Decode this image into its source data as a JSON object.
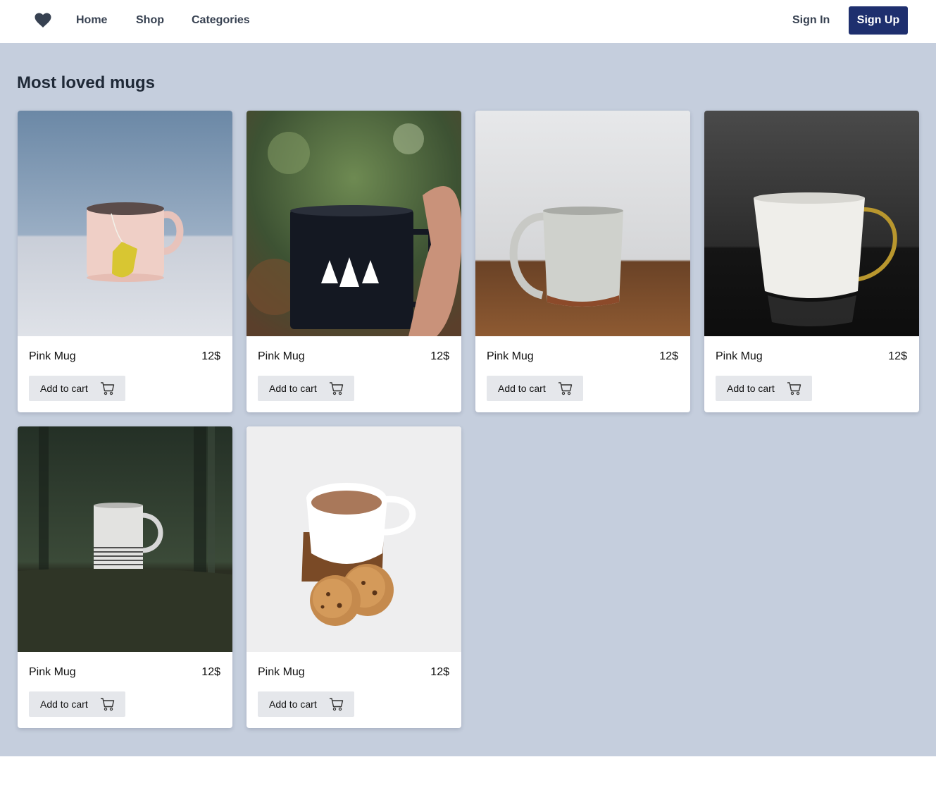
{
  "nav": {
    "logo_icon": "heart-icon",
    "links": [
      "Home",
      "Shop",
      "Categories"
    ],
    "sign_in": "Sign In",
    "sign_up": "Sign Up"
  },
  "page": {
    "title": "Most loved mugs"
  },
  "products": [
    {
      "name": "Pink Mug",
      "price": "12$",
      "button": "Add to cart",
      "image": "pink-mug-photo"
    },
    {
      "name": "Pink Mug",
      "price": "12$",
      "button": "Add to cart",
      "image": "black-enamel-mug-photo"
    },
    {
      "name": "Pink Mug",
      "price": "12$",
      "button": "Add to cart",
      "image": "grey-ceramic-mug-photo"
    },
    {
      "name": "Pink Mug",
      "price": "12$",
      "button": "Add to cart",
      "image": "white-gold-handle-mug-photo"
    },
    {
      "name": "Pink Mug",
      "price": "12$",
      "button": "Add to cart",
      "image": "striped-mug-forest-photo"
    },
    {
      "name": "Pink Mug",
      "price": "12$",
      "button": "Add to cart",
      "image": "coffee-cup-cookies-photo"
    }
  ],
  "colors": {
    "page_bg": "#c5cedd",
    "primary_button": "#1e2f6e",
    "cart_button": "#e5e7eb"
  }
}
